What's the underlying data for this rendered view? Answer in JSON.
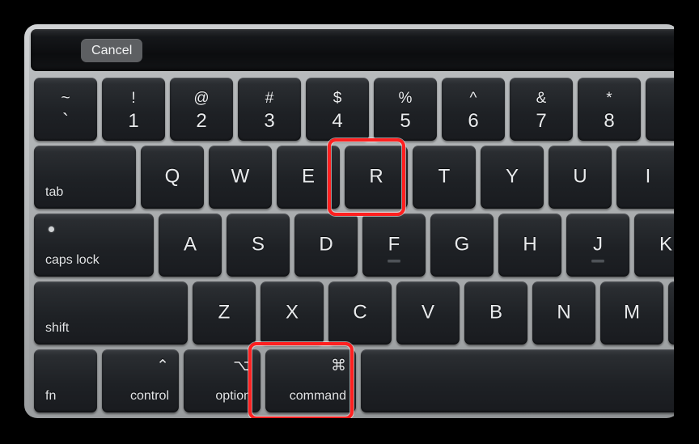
{
  "window": {
    "device": "MacBook Pro keyboard with Touch Bar",
    "background_color": "#000000",
    "chassis_color": "#b6b9bb",
    "key_color": "#1e2125",
    "key_text_color": "#e9ebed",
    "annotation_color": "#ff2020"
  },
  "touch_bar": {
    "background_color": "#0c0d0f",
    "cancel_label": "Cancel",
    "cancel_bg_color": "#5d5f62"
  },
  "annotations": [
    {
      "target": "key-r",
      "label": "R",
      "color": "#ff2020"
    },
    {
      "target": "key-command-left",
      "label": "command",
      "color": "#ff2020"
    }
  ],
  "rows": {
    "number": [
      {
        "name": "grave",
        "upper": "~",
        "lower": "`",
        "style": "dual"
      },
      {
        "name": "1",
        "upper": "!",
        "lower": "1",
        "style": "dual"
      },
      {
        "name": "2",
        "upper": "@",
        "lower": "2",
        "style": "dual"
      },
      {
        "name": "3",
        "upper": "#",
        "lower": "3",
        "style": "dual"
      },
      {
        "name": "4",
        "upper": "$",
        "lower": "4",
        "style": "dual"
      },
      {
        "name": "5",
        "upper": "%",
        "lower": "5",
        "style": "dual"
      },
      {
        "name": "6",
        "upper": "^",
        "lower": "6",
        "style": "dual"
      },
      {
        "name": "7",
        "upper": "&",
        "lower": "7",
        "style": "dual"
      },
      {
        "name": "8",
        "upper": "*",
        "lower": "8",
        "style": "dual"
      }
    ],
    "qwerty": [
      {
        "name": "tab",
        "label": "tab",
        "style": "bottom-left"
      },
      {
        "name": "q",
        "label": "Q",
        "style": "center"
      },
      {
        "name": "w",
        "label": "W",
        "style": "center"
      },
      {
        "name": "e",
        "label": "E",
        "style": "center"
      },
      {
        "name": "r",
        "label": "R",
        "style": "center",
        "highlighted": true
      },
      {
        "name": "t",
        "label": "T",
        "style": "center"
      },
      {
        "name": "y",
        "label": "Y",
        "style": "center"
      },
      {
        "name": "u",
        "label": "U",
        "style": "center"
      },
      {
        "name": "i",
        "label": "I",
        "style": "center"
      }
    ],
    "home": [
      {
        "name": "caps-lock",
        "label": "caps lock",
        "style": "bottom-left",
        "indicator": true
      },
      {
        "name": "a",
        "label": "A",
        "style": "center"
      },
      {
        "name": "s",
        "label": "S",
        "style": "center"
      },
      {
        "name": "d",
        "label": "D",
        "style": "center"
      },
      {
        "name": "f",
        "label": "F",
        "style": "center",
        "home_marker": true
      },
      {
        "name": "g",
        "label": "G",
        "style": "center"
      },
      {
        "name": "h",
        "label": "H",
        "style": "center"
      },
      {
        "name": "j",
        "label": "J",
        "style": "center",
        "home_marker": true
      },
      {
        "name": "k",
        "label": "K",
        "style": "center"
      }
    ],
    "shift": [
      {
        "name": "shift-left",
        "label": "shift",
        "style": "bottom-left"
      },
      {
        "name": "z",
        "label": "Z",
        "style": "center"
      },
      {
        "name": "x",
        "label": "X",
        "style": "center"
      },
      {
        "name": "c",
        "label": "C",
        "style": "center"
      },
      {
        "name": "v",
        "label": "V",
        "style": "center"
      },
      {
        "name": "b",
        "label": "B",
        "style": "center"
      },
      {
        "name": "n",
        "label": "N",
        "style": "center"
      },
      {
        "name": "m",
        "label": "M",
        "style": "center"
      }
    ],
    "modifier": [
      {
        "name": "fn",
        "label": "fn",
        "symbol": "",
        "style": "bottom-left"
      },
      {
        "name": "control",
        "label": "control",
        "symbol": "⌃",
        "style": "mod"
      },
      {
        "name": "option",
        "label": "option",
        "symbol": "⌥",
        "style": "mod"
      },
      {
        "name": "command-left",
        "label": "command",
        "symbol": "⌘",
        "style": "mod",
        "highlighted": true
      },
      {
        "name": "space",
        "label": "",
        "symbol": "",
        "style": "blank"
      }
    ]
  }
}
